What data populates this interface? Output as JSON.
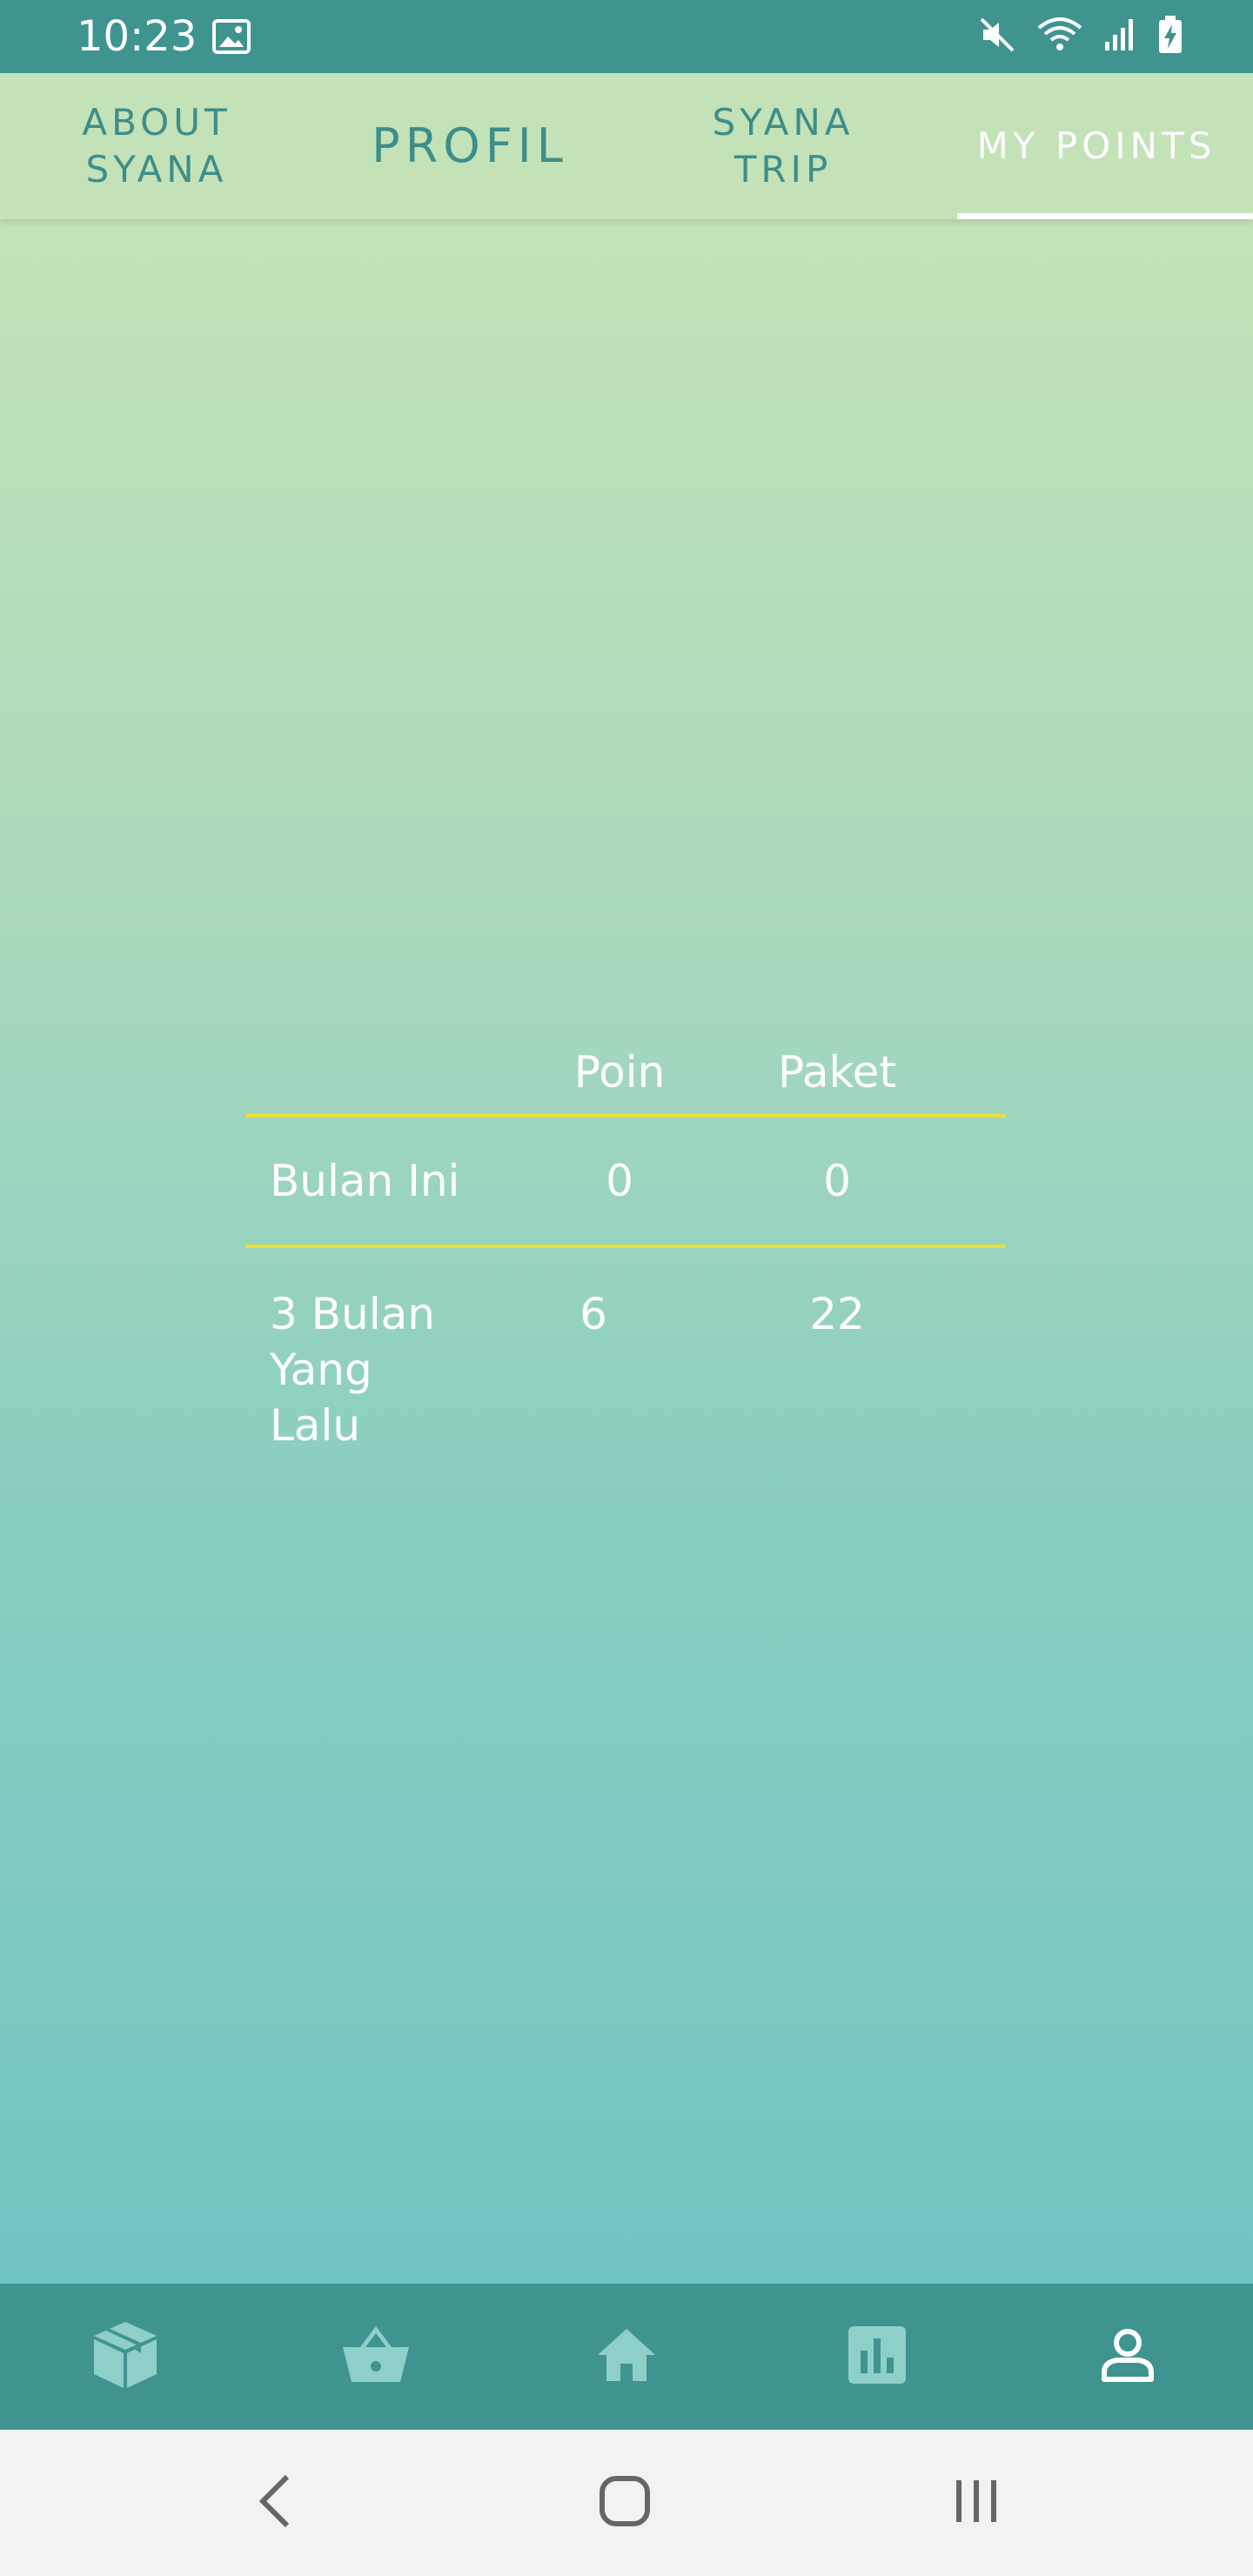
{
  "status_bar": {
    "time": "10:23",
    "icons": [
      "image-icon",
      "mute-icon",
      "wifi-icon",
      "signal-icon",
      "battery-charging-icon"
    ]
  },
  "tabs": [
    {
      "label": "ABOUT\nSYANA",
      "active": false
    },
    {
      "label": "PROFIL",
      "active": false
    },
    {
      "label": "SYANA\nTRIP",
      "active": false
    },
    {
      "label": "MY POINTS",
      "active": true
    }
  ],
  "points_table": {
    "headers": {
      "label": "",
      "poin": "Poin",
      "paket": "Paket"
    },
    "rows": [
      {
        "label": "Bulan Ini",
        "poin": "0",
        "paket": "0"
      },
      {
        "label": "3 Bulan\nYang\nLalu",
        "poin": "6",
        "paket": "22"
      }
    ]
  },
  "bottom_nav": {
    "items": [
      "package-icon",
      "basket-icon",
      "home-icon",
      "chart-icon",
      "profile-icon"
    ],
    "active": "profile-icon"
  },
  "system_nav": {
    "buttons": [
      "back-icon",
      "home-circle-icon",
      "recents-icon"
    ]
  },
  "colors": {
    "header_teal": "#3f9490",
    "tab_background": "#c3e2b7",
    "tab_text": "#3d8e8a",
    "divider_yellow": "#e9e13a",
    "gradient_top": "#c3e2b7",
    "gradient_bottom": "#70c4c2"
  }
}
